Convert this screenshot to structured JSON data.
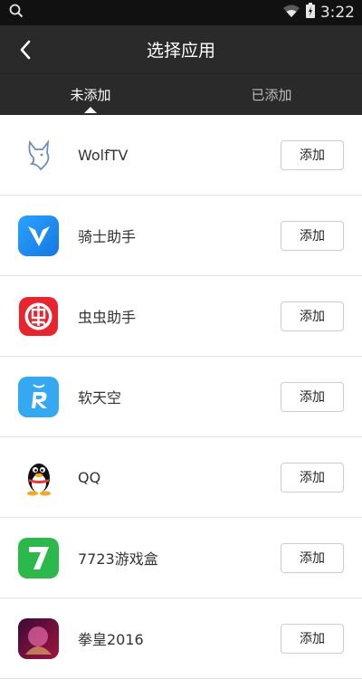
{
  "status_bar": {
    "time": "3:22",
    "icons": [
      "search-icon",
      "wifi-icon",
      "battery-icon"
    ]
  },
  "header": {
    "title": "选择应用",
    "back_icon": "chevron-left-icon"
  },
  "tabs": [
    {
      "label": "未添加",
      "active": true
    },
    {
      "label": "已添加",
      "active": false
    }
  ],
  "apps": [
    {
      "name": "WolfTV",
      "action": "添加",
      "icon": "wolf-icon"
    },
    {
      "name": "骑士助手",
      "action": "添加",
      "icon": "knight-v-icon"
    },
    {
      "name": "虫虫助手",
      "action": "添加",
      "icon": "bug-icon"
    },
    {
      "name": "软天空",
      "action": "添加",
      "icon": "sky-r-icon"
    },
    {
      "name": "QQ",
      "action": "添加",
      "icon": "penguin-icon"
    },
    {
      "name": "7723游戏盒",
      "action": "添加",
      "icon": "seven-icon"
    },
    {
      "name": "拳皇2016",
      "action": "添加",
      "icon": "kof-icon"
    }
  ],
  "colors": {
    "topbar": "#2a2a2a",
    "statusbar": "#111111",
    "divider": "#e2e2e2"
  }
}
